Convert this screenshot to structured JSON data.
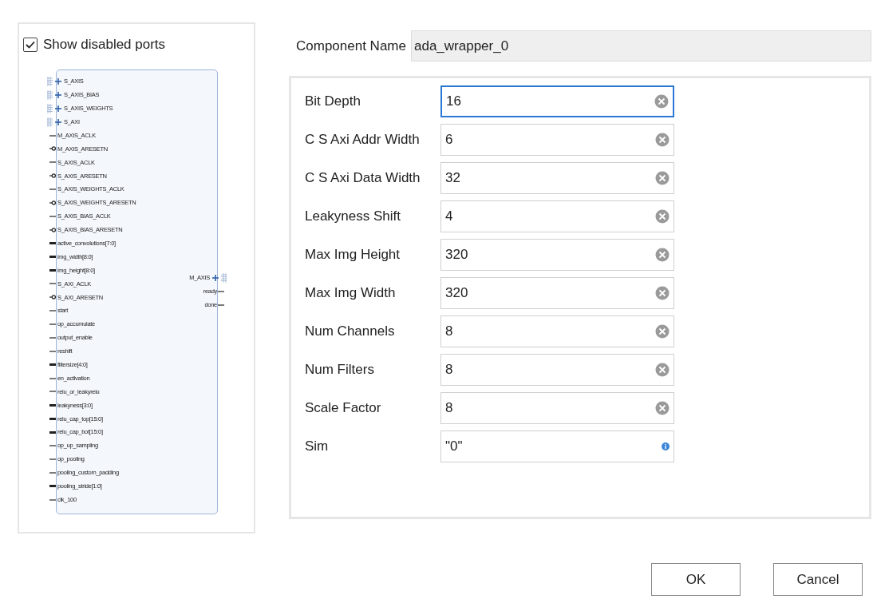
{
  "show_disabled_ports": {
    "label": "Show disabled ports",
    "checked": true
  },
  "block": {
    "left_ports": [
      {
        "name": "S_AXIS",
        "kind": "bus"
      },
      {
        "name": "S_AXIS_BIAS",
        "kind": "bus"
      },
      {
        "name": "S_AXIS_WEIGHTS",
        "kind": "bus"
      },
      {
        "name": "S_AXI",
        "kind": "bus"
      },
      {
        "name": "M_AXIS_ACLK",
        "kind": "wire"
      },
      {
        "name": "M_AXIS_ARESETN",
        "kind": "reset"
      },
      {
        "name": "S_AXIS_ACLK",
        "kind": "wire"
      },
      {
        "name": "S_AXIS_ARESETN",
        "kind": "reset"
      },
      {
        "name": "S_AXIS_WEIGHTS_ACLK",
        "kind": "wire"
      },
      {
        "name": "S_AXIS_WEIGHTS_ARESETN",
        "kind": "reset"
      },
      {
        "name": "S_AXIS_BIAS_ACLK",
        "kind": "wire"
      },
      {
        "name": "S_AXIS_BIAS_ARESETN",
        "kind": "reset"
      },
      {
        "name": "active_convolutions[7:0]",
        "kind": "vector"
      },
      {
        "name": "img_width[8:0]",
        "kind": "vector"
      },
      {
        "name": "img_height[8:0]",
        "kind": "vector"
      },
      {
        "name": "S_AXI_ACLK",
        "kind": "wire"
      },
      {
        "name": "S_AXI_ARESETN",
        "kind": "reset"
      },
      {
        "name": "start",
        "kind": "wire"
      },
      {
        "name": "op_accumulate",
        "kind": "wire"
      },
      {
        "name": "output_enable",
        "kind": "wire"
      },
      {
        "name": "reshift",
        "kind": "wire"
      },
      {
        "name": "filtersize[4:0]",
        "kind": "vector"
      },
      {
        "name": "en_activation",
        "kind": "wire"
      },
      {
        "name": "relu_or_leakyrelu",
        "kind": "wire"
      },
      {
        "name": "leakyness[3:0]",
        "kind": "vector"
      },
      {
        "name": "relu_cap_top[15:0]",
        "kind": "vector"
      },
      {
        "name": "relu_cap_bot[15:0]",
        "kind": "vector"
      },
      {
        "name": "op_up_sampling",
        "kind": "wire"
      },
      {
        "name": "op_pooling",
        "kind": "wire"
      },
      {
        "name": "pooling_custom_padding",
        "kind": "wire"
      },
      {
        "name": "pooling_stride[1:0]",
        "kind": "vector"
      },
      {
        "name": "clk_100",
        "kind": "wire"
      }
    ],
    "right_ports": [
      {
        "name": "M_AXIS",
        "kind": "bus"
      },
      {
        "name": "ready",
        "kind": "wire"
      },
      {
        "name": "done",
        "kind": "wire"
      }
    ]
  },
  "component_name": {
    "label": "Component Name",
    "value": "ada_wrapper_0"
  },
  "parameters": [
    {
      "label": "Bit Depth",
      "value": "16",
      "kind": "clearable",
      "focused": true
    },
    {
      "label": "C S Axi Addr Width",
      "value": "6",
      "kind": "clearable",
      "focused": false
    },
    {
      "label": "C S Axi Data Width",
      "value": "32",
      "kind": "clearable",
      "focused": false
    },
    {
      "label": "Leakyness Shift",
      "value": "4",
      "kind": "clearable",
      "focused": false
    },
    {
      "label": "Max Img Height",
      "value": "320",
      "kind": "clearable",
      "focused": false
    },
    {
      "label": "Max Img Width",
      "value": "320",
      "kind": "clearable",
      "focused": false
    },
    {
      "label": "Num Channels",
      "value": "8",
      "kind": "clearable",
      "focused": false
    },
    {
      "label": "Num Filters",
      "value": "8",
      "kind": "clearable",
      "focused": false
    },
    {
      "label": "Scale Factor",
      "value": "8",
      "kind": "clearable",
      "focused": false
    },
    {
      "label": "Sim",
      "value": "\"0\"",
      "kind": "info",
      "focused": false
    }
  ],
  "buttons": [
    "OK",
    "Cancel"
  ]
}
